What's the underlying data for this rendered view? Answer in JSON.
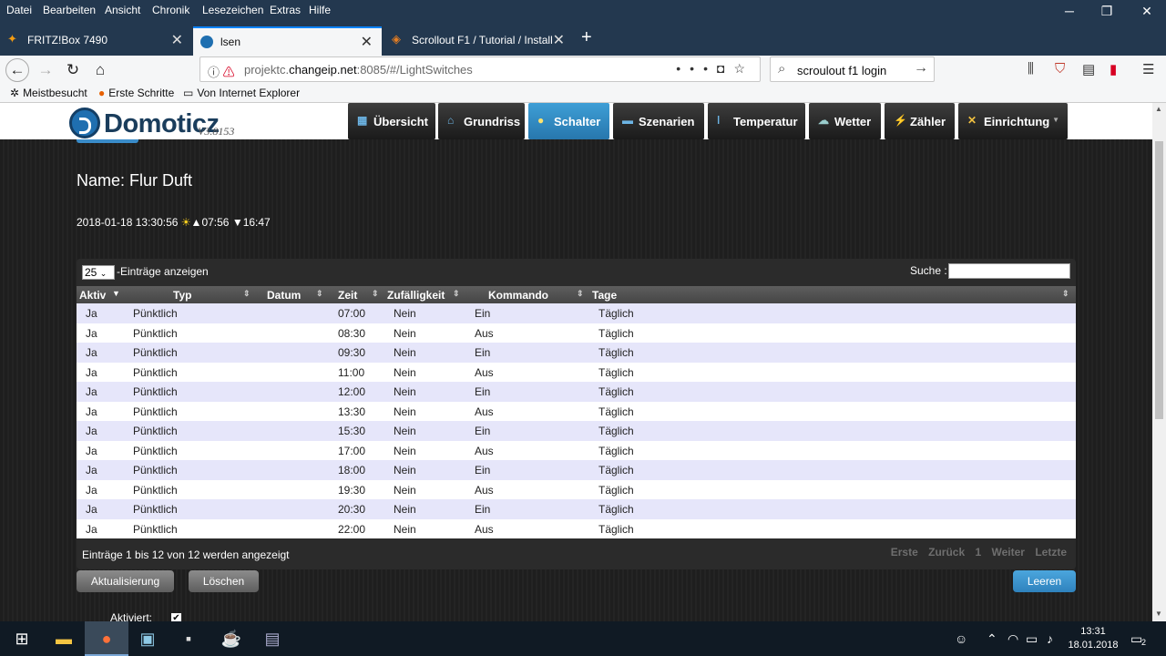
{
  "browser": {
    "menu": [
      "Datei",
      "Bearbeiten",
      "Ansicht",
      "Chronik",
      "Lesezeichen",
      "Extras",
      "Hilfe"
    ],
    "tabs": [
      {
        "label": "FRITZ!Box 7490"
      },
      {
        "label": "lsen"
      },
      {
        "label": "Scrollout F1 / Tutorial / Install"
      }
    ],
    "url_prefix": "projektc.",
    "url_domain": "changeip.net",
    "url_suffix": ":8085/#/LightSwitches",
    "search_value": "scroulout f1 login",
    "bookmarks": [
      "Meistbesucht",
      "Erste Schritte",
      "Von Internet Explorer"
    ]
  },
  "app": {
    "logo_text": "Domoticz",
    "version": "V3.8153",
    "nav": [
      {
        "label": "Übersicht",
        "icon": "overview-icon"
      },
      {
        "label": "Grundriss",
        "icon": "floorplan-icon"
      },
      {
        "label": "Schalter",
        "icon": "lightbulb-icon"
      },
      {
        "label": "Szenarien",
        "icon": "scenes-icon"
      },
      {
        "label": "Temperatur",
        "icon": "thermometer-icon"
      },
      {
        "label": "Wetter",
        "icon": "weather-icon"
      },
      {
        "label": "Zähler",
        "icon": "meter-icon"
      },
      {
        "label": "Einrichtung",
        "icon": "setup-icon"
      }
    ],
    "active_nav": "Schalter"
  },
  "device": {
    "name": "Name: Flur Duft",
    "datetime": "2018-01-18 13:30:56",
    "sunrise": "07:56",
    "sunset": "16:47"
  },
  "table": {
    "page_length": "25",
    "length_suffix": "-Einträge anzeigen",
    "search_label": "Suche :",
    "columns": [
      "Aktiv",
      "Typ",
      "Datum",
      "Zeit",
      "Zufälligkeit",
      "Kommando",
      "Tage"
    ],
    "rows": [
      {
        "aktiv": "Ja",
        "typ": "Pünktlich",
        "datum": "",
        "zeit": "07:00",
        "zufall": "Nein",
        "kommando": "Ein",
        "tage": "Täglich"
      },
      {
        "aktiv": "Ja",
        "typ": "Pünktlich",
        "datum": "",
        "zeit": "08:30",
        "zufall": "Nein",
        "kommando": "Aus",
        "tage": "Täglich"
      },
      {
        "aktiv": "Ja",
        "typ": "Pünktlich",
        "datum": "",
        "zeit": "09:30",
        "zufall": "Nein",
        "kommando": "Ein",
        "tage": "Täglich"
      },
      {
        "aktiv": "Ja",
        "typ": "Pünktlich",
        "datum": "",
        "zeit": "11:00",
        "zufall": "Nein",
        "kommando": "Aus",
        "tage": "Täglich"
      },
      {
        "aktiv": "Ja",
        "typ": "Pünktlich",
        "datum": "",
        "zeit": "12:00",
        "zufall": "Nein",
        "kommando": "Ein",
        "tage": "Täglich"
      },
      {
        "aktiv": "Ja",
        "typ": "Pünktlich",
        "datum": "",
        "zeit": "13:30",
        "zufall": "Nein",
        "kommando": "Aus",
        "tage": "Täglich"
      },
      {
        "aktiv": "Ja",
        "typ": "Pünktlich",
        "datum": "",
        "zeit": "15:30",
        "zufall": "Nein",
        "kommando": "Ein",
        "tage": "Täglich"
      },
      {
        "aktiv": "Ja",
        "typ": "Pünktlich",
        "datum": "",
        "zeit": "17:00",
        "zufall": "Nein",
        "kommando": "Aus",
        "tage": "Täglich"
      },
      {
        "aktiv": "Ja",
        "typ": "Pünktlich",
        "datum": "",
        "zeit": "18:00",
        "zufall": "Nein",
        "kommando": "Ein",
        "tage": "Täglich"
      },
      {
        "aktiv": "Ja",
        "typ": "Pünktlich",
        "datum": "",
        "zeit": "19:30",
        "zufall": "Nein",
        "kommando": "Aus",
        "tage": "Täglich"
      },
      {
        "aktiv": "Ja",
        "typ": "Pünktlich",
        "datum": "",
        "zeit": "20:30",
        "zufall": "Nein",
        "kommando": "Ein",
        "tage": "Täglich"
      },
      {
        "aktiv": "Ja",
        "typ": "Pünktlich",
        "datum": "",
        "zeit": "22:00",
        "zufall": "Nein",
        "kommando": "Aus",
        "tage": "Täglich"
      }
    ],
    "info": "Einträge 1 bis 12 von 12 werden angezeigt",
    "pager": {
      "first": "Erste",
      "prev": "Zurück",
      "page": "1",
      "next": "Weiter",
      "last": "Letzte"
    }
  },
  "actions": {
    "refresh": "Aktualisierung",
    "delete": "Löschen",
    "clear": "Leeren",
    "activated_label": "Aktiviert:"
  },
  "taskbar": {
    "time": "13:31",
    "date": "18.01.2018",
    "notifications": "2"
  },
  "colors": {
    "accent": "#2f82bd",
    "row_odd": "#e6e6fa",
    "titlebar": "#23384f"
  }
}
